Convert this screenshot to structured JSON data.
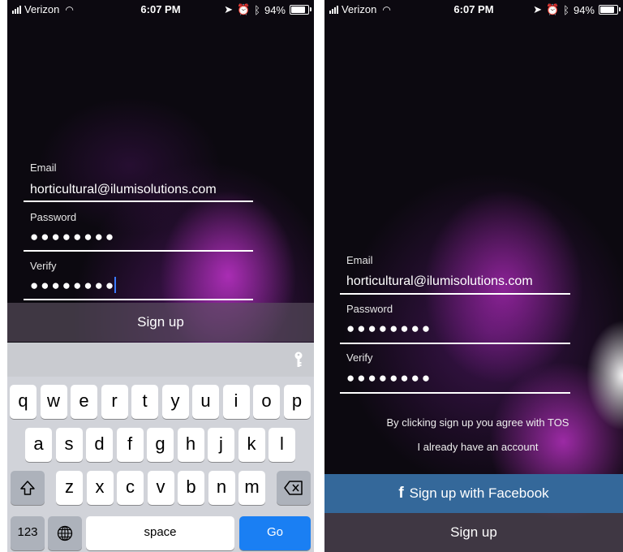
{
  "status_bar": {
    "carrier": "Verizon",
    "time": "6:07 PM",
    "battery": "94%",
    "battery_level": 0.94
  },
  "form": {
    "email_label": "Email",
    "email_value": "horticultural@ilumisolutions.com",
    "password_label": "Password",
    "password_value": "●●●●●●●●",
    "verify_label": "Verify",
    "verify_value": "●●●●●●●●"
  },
  "actions": {
    "signup_label": "Sign up",
    "facebook_label": "Sign up with Facebook",
    "tos_text": "By clicking sign up you agree with TOS",
    "login_link": "I already have an account"
  },
  "keyboard": {
    "row1": [
      "q",
      "w",
      "e",
      "r",
      "t",
      "y",
      "u",
      "i",
      "o",
      "p"
    ],
    "row2": [
      "a",
      "s",
      "d",
      "f",
      "g",
      "h",
      "j",
      "k",
      "l"
    ],
    "row3": [
      "z",
      "x",
      "c",
      "v",
      "b",
      "n",
      "m"
    ],
    "numbers_label": "123",
    "space_label": "space",
    "go_label": "Go"
  },
  "colors": {
    "facebook": "#34689a",
    "go_key": "#1a7ff3",
    "caret": "#3a7bff"
  },
  "icons": {
    "signal": "signal-bars-icon",
    "wifi": "wifi-icon",
    "location": "location-arrow-icon",
    "alarm": "alarm-icon",
    "bluetooth": "bluetooth-icon",
    "battery": "battery-icon",
    "password_key": "key-icon",
    "shift": "shift-icon",
    "globe": "globe-icon",
    "backspace": "backspace-icon",
    "facebook": "facebook-f-icon"
  }
}
